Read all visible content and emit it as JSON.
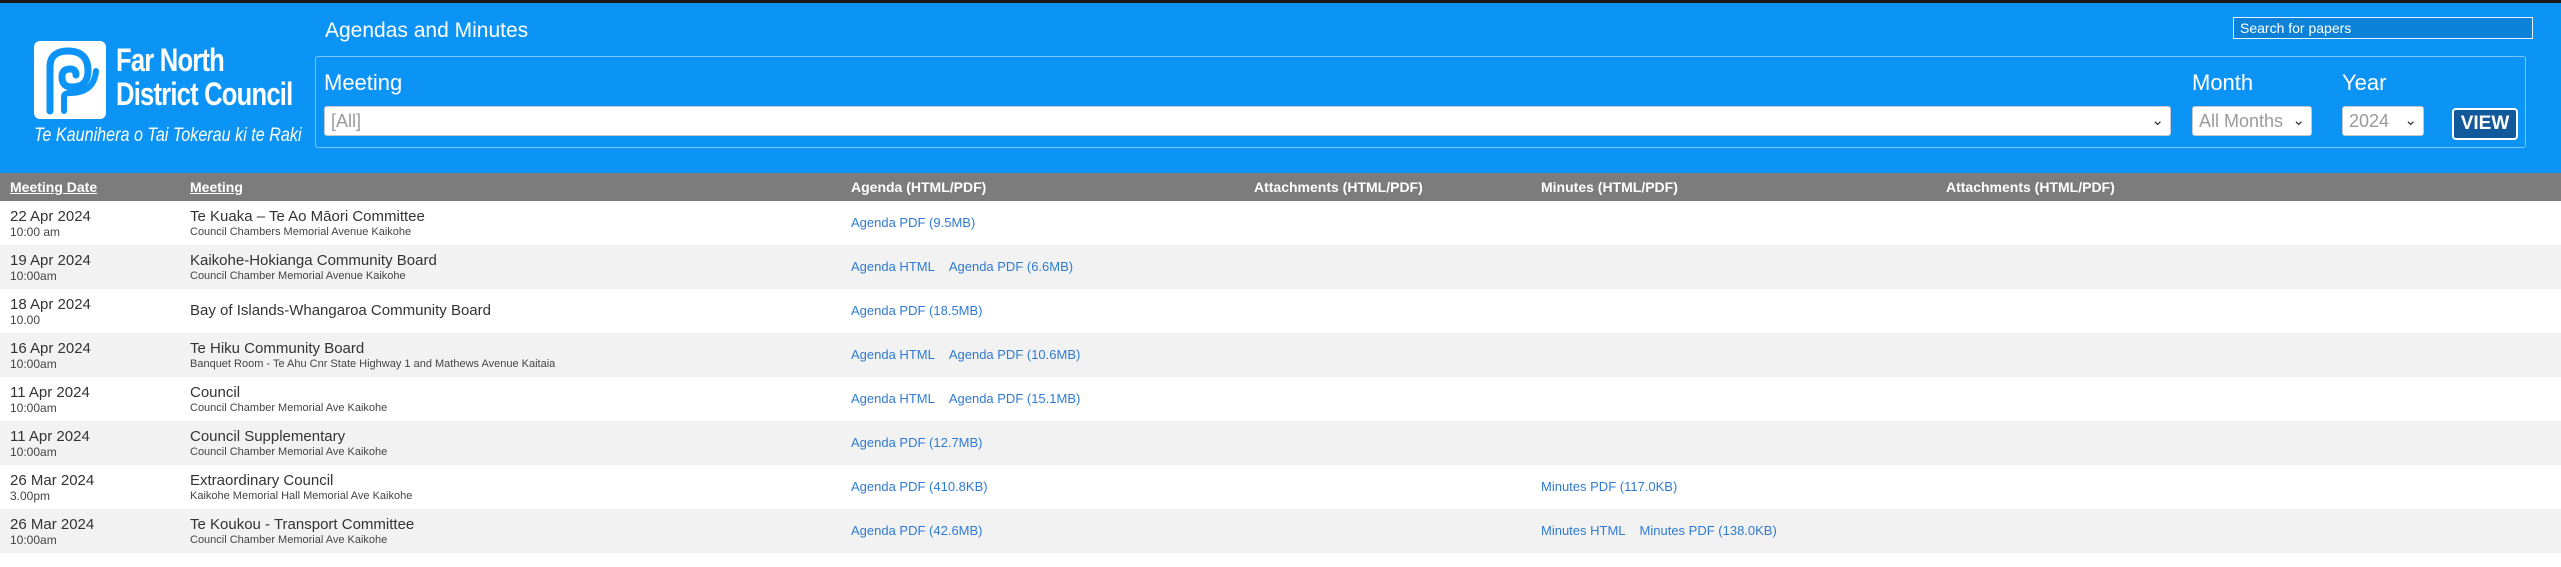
{
  "header": {
    "logo": {
      "name_line1": "Far North",
      "name_line2": "District Council",
      "tagline": "Te Kaunihera o Tai Tokerau ki te Raki"
    },
    "page_title": "Agendas and Minutes",
    "search_placeholder": "Search for papers"
  },
  "filters": {
    "meeting_label": "Meeting",
    "meeting_value": "[All]",
    "month_label": "Month",
    "month_value": "All Months",
    "year_label": "Year",
    "year_value": "2024",
    "view_button": "VIEW"
  },
  "table": {
    "columns": [
      "Meeting Date",
      "Meeting",
      "Agenda (HTML/PDF)",
      "Attachments (HTML/PDF)",
      "Minutes (HTML/PDF)",
      "Attachments (HTML/PDF)"
    ],
    "rows": [
      {
        "date": "22 Apr 2024",
        "time": "10:00 am",
        "meeting": "Te Kuaka – Te Ao Māori Committee",
        "venue": "Council Chambers Memorial Avenue Kaikohe",
        "agenda_html": "",
        "agenda_pdf": "Agenda PDF (9.5MB)",
        "minutes_html": "",
        "minutes_pdf": ""
      },
      {
        "date": "19 Apr 2024",
        "time": "10:00am",
        "meeting": "Kaikohe-Hokianga Community Board",
        "venue": "Council Chamber Memorial Avenue Kaikohe",
        "agenda_html": "Agenda HTML",
        "agenda_pdf": "Agenda PDF (6.6MB)",
        "minutes_html": "",
        "minutes_pdf": ""
      },
      {
        "date": "18 Apr 2024",
        "time": "10.00",
        "meeting": "Bay of Islands-Whangaroa Community Board",
        "venue": "",
        "agenda_html": "",
        "agenda_pdf": "Agenda PDF (18.5MB)",
        "minutes_html": "",
        "minutes_pdf": ""
      },
      {
        "date": "16 Apr 2024",
        "time": "10:00am",
        "meeting": "Te Hiku Community Board",
        "venue": "Banquet Room - Te Ahu Cnr State Highway 1 and Mathews Avenue Kaitaia",
        "agenda_html": "Agenda HTML",
        "agenda_pdf": "Agenda PDF (10.6MB)",
        "minutes_html": "",
        "minutes_pdf": ""
      },
      {
        "date": "11 Apr 2024",
        "time": "10:00am",
        "meeting": "Council",
        "venue": "Council Chamber Memorial Ave Kaikohe",
        "agenda_html": "Agenda HTML",
        "agenda_pdf": "Agenda PDF (15.1MB)",
        "minutes_html": "",
        "minutes_pdf": ""
      },
      {
        "date": "11 Apr 2024",
        "time": "10:00am",
        "meeting": "Council Supplementary",
        "venue": "Council Chamber Memorial Ave Kaikohe",
        "agenda_html": "",
        "agenda_pdf": "Agenda PDF (12.7MB)",
        "minutes_html": "",
        "minutes_pdf": ""
      },
      {
        "date": "26 Mar 2024",
        "time": "3.00pm",
        "meeting": "Extraordinary Council",
        "venue": "Kaikohe Memorial Hall Memorial Ave Kaikohe",
        "agenda_html": "",
        "agenda_pdf": "Agenda PDF (410.8KB)",
        "minutes_html": "",
        "minutes_pdf": "Minutes PDF (117.0KB)"
      },
      {
        "date": "26 Mar 2024",
        "time": "10:00am",
        "meeting": "Te Koukou - Transport Committee",
        "venue": "Council Chamber Memorial Ave Kaikohe",
        "agenda_html": "",
        "agenda_pdf": "Agenda PDF (42.6MB)",
        "minutes_html": "Minutes HTML",
        "minutes_pdf": "Minutes PDF (138.0KB)"
      }
    ]
  }
}
